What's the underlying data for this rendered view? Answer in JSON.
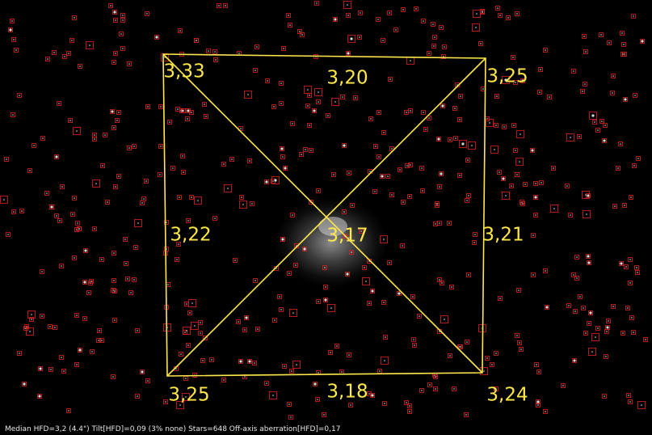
{
  "image": {
    "subject": "star field with central galaxy (astrophotography frame)",
    "overlay_color": "#ffe84a",
    "star_marker_color": "#e02020"
  },
  "hfd_grid": {
    "top_left": "3,33",
    "top_center": "3,20",
    "top_right": "3,25",
    "middle_left": "3,22",
    "center": "3,17",
    "middle_right": "3,21",
    "bottom_left": "3,25",
    "bottom_center": "3,18",
    "bottom_right": "3,24"
  },
  "status_bar": {
    "text": "Median HFD=3,2 (4.4\")  Tilt[HFD]=0,09 (3% none)  Stars=648  Off-axis aberration[HFD]=0,17"
  }
}
